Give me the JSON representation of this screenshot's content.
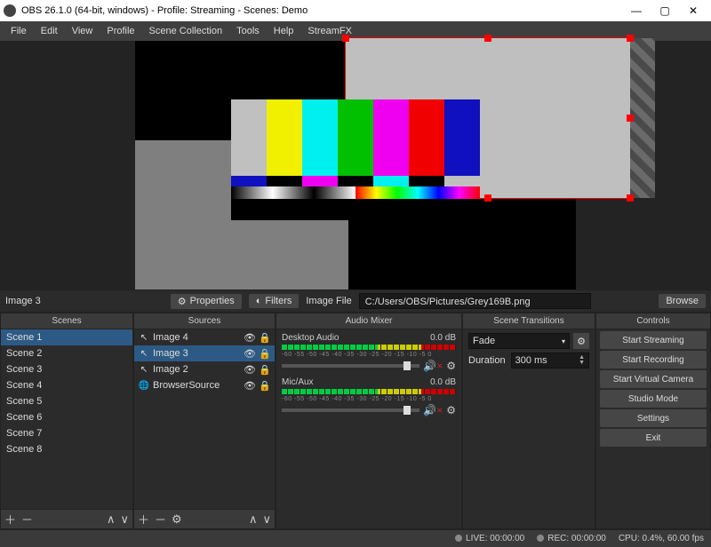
{
  "window": {
    "title": "OBS 26.1.0 (64-bit, windows) - Profile: Streaming - Scenes: Demo"
  },
  "menu": [
    "File",
    "Edit",
    "View",
    "Profile",
    "Scene Collection",
    "Tools",
    "Help",
    "StreamFX"
  ],
  "source_selected_label": "Image 3",
  "prop_buttons": {
    "properties": "Properties",
    "filters": "Filters"
  },
  "image_file": {
    "label": "Image File",
    "value": "C:/Users/OBS/Pictures/Grey169B.png",
    "browse": "Browse"
  },
  "panel_headers": {
    "scenes": "Scenes",
    "sources": "Sources",
    "mixer": "Audio Mixer",
    "transitions": "Scene Transitions",
    "controls": "Controls"
  },
  "scenes": [
    "Scene 1",
    "Scene 2",
    "Scene 3",
    "Scene 4",
    "Scene 5",
    "Scene 6",
    "Scene 7",
    "Scene 8"
  ],
  "sources": [
    {
      "name": "Image 4",
      "type": "image"
    },
    {
      "name": "Image 3",
      "type": "image"
    },
    {
      "name": "Image 2",
      "type": "image"
    },
    {
      "name": "BrowserSource",
      "type": "browser"
    }
  ],
  "mixer": {
    "ticks": "-60  -55  -50  -45  -40  -35  -30  -25  -20  -15  -10  -5  0",
    "channels": [
      {
        "name": "Desktop Audio",
        "level": "0.0 dB"
      },
      {
        "name": "Mic/Aux",
        "level": "0.0 dB"
      }
    ]
  },
  "transitions": {
    "selected": "Fade",
    "duration_label": "Duration",
    "duration_value": "300 ms"
  },
  "controls": [
    "Start Streaming",
    "Start Recording",
    "Start Virtual Camera",
    "Studio Mode",
    "Settings",
    "Exit"
  ],
  "status": {
    "live": "LIVE: 00:00:00",
    "rec": "REC: 00:00:00",
    "cpu": "CPU: 0.4%, 60.00 fps"
  }
}
